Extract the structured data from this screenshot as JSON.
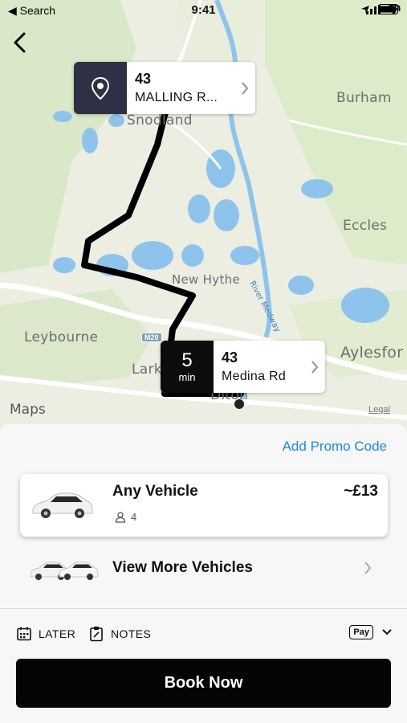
{
  "status_bar": {
    "back_label": "◀ Search",
    "time": "9:41"
  },
  "map": {
    "labels": {
      "burham": "Burham",
      "snodland": "Snodland",
      "eccles": "Eccles",
      "new_hythe": "New Hythe",
      "leybourne": "Leybourne",
      "aylesford": "Aylesfor",
      "larkfield": "Lark",
      "ditton": "Diton",
      "river_medway": "River Medway",
      "road": "M20"
    },
    "attribution": "Maps",
    "legal": "Legal"
  },
  "pickup": {
    "number": "43",
    "street": "MALLING R..."
  },
  "dropoff": {
    "eta_value": "5",
    "eta_unit": "min",
    "number": "43",
    "street": "Medina Rd"
  },
  "sheet": {
    "promo_label": "Add Promo Code",
    "vehicle": {
      "name": "Any Vehicle",
      "seats": "4",
      "price": "~£13"
    },
    "more_label": "View More Vehicles",
    "later_label": "LATER",
    "notes_label": "NOTES",
    "pay_label": "Pay",
    "book_label": "Book Now"
  },
  "colors": {
    "accent": "#1a8ae6",
    "route": "#000000",
    "pickup_box": "#2f2f45",
    "book_button": "#070404"
  }
}
